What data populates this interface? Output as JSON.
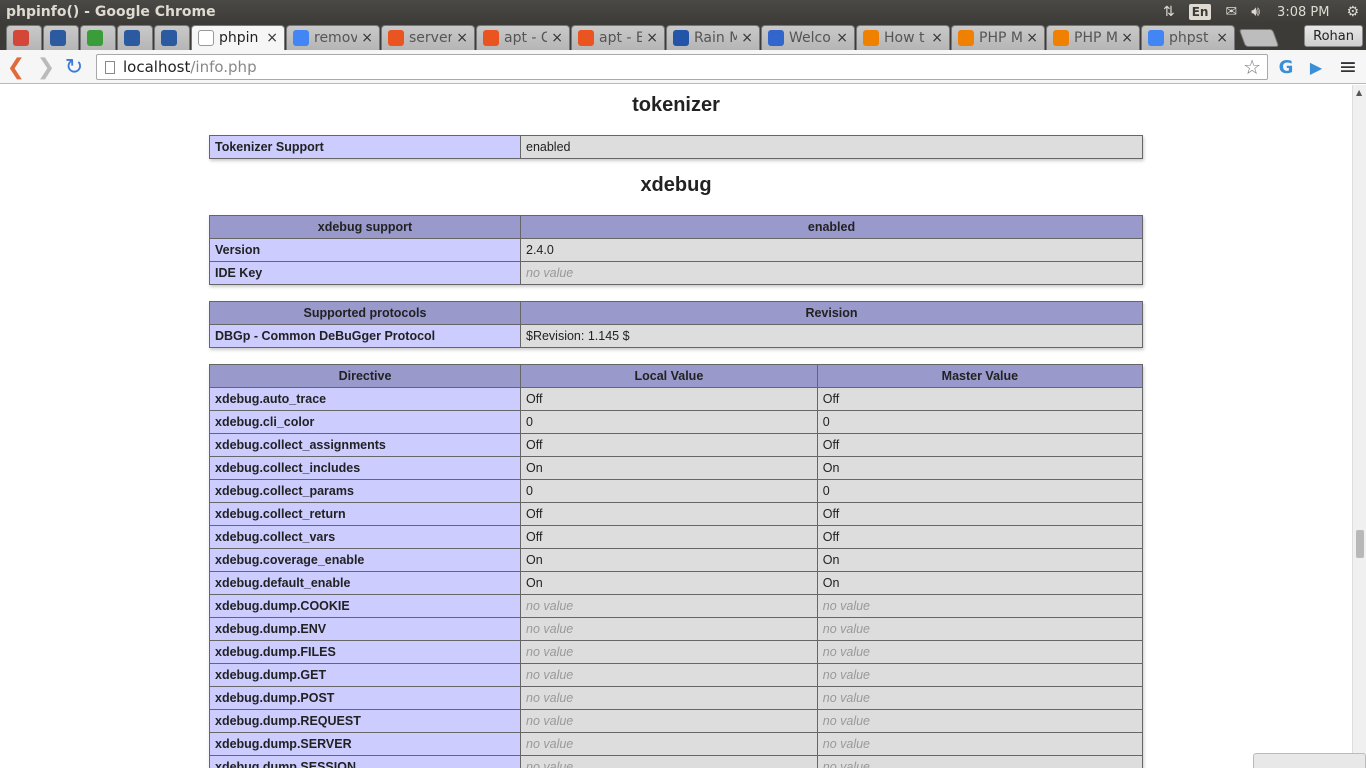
{
  "os_panel": {
    "window_title": "phpinfo() - Google Chrome",
    "lang": "En",
    "clock": "3:08 PM",
    "icons": [
      "network-updown-icon",
      "mail-icon",
      "volume-icon",
      "settings-gear-icon"
    ]
  },
  "tabs": [
    {
      "label": "",
      "favicon": "gmail-icon",
      "color": "#d44638",
      "active": false
    },
    {
      "label": "",
      "favicon": "jenkins-icon",
      "color": "#2c5aa0",
      "active": false
    },
    {
      "label": "",
      "favicon": "speedometer-icon",
      "color": "#3a9d3a",
      "active": false
    },
    {
      "label": "",
      "favicon": "jenkins-icon",
      "color": "#2c5aa0",
      "active": false
    },
    {
      "label": "",
      "favicon": "jenkins-icon",
      "color": "#2c5aa0",
      "active": false
    },
    {
      "label": "phpin",
      "favicon": "page-icon",
      "color": "#ffffff",
      "active": true
    },
    {
      "label": "remov",
      "favicon": "google-icon",
      "color": "#4285f4",
      "active": false
    },
    {
      "label": "server",
      "favicon": "askubuntu-icon",
      "color": "#e95420",
      "active": false
    },
    {
      "label": "apt - C",
      "favicon": "askubuntu-icon",
      "color": "#e95420",
      "active": false
    },
    {
      "label": "apt - E",
      "favicon": "askubuntu-icon",
      "color": "#e95420",
      "active": false
    },
    {
      "label": "Rain M",
      "favicon": "grid-icon",
      "color": "#2255aa",
      "active": false
    },
    {
      "label": "Welco",
      "favicon": "grid-icon",
      "color": "#3366cc",
      "active": false
    },
    {
      "label": "How t",
      "favicon": "sublime-icon",
      "color": "#f08000",
      "active": false
    },
    {
      "label": "PHP M",
      "favicon": "sublime-icon",
      "color": "#f08000",
      "active": false
    },
    {
      "label": "PHP M",
      "favicon": "sublime-icon",
      "color": "#f08000",
      "active": false
    },
    {
      "label": "phpst",
      "favicon": "google-icon",
      "color": "#4285f4",
      "active": false
    }
  ],
  "profile": "Rohan",
  "toolbar": {
    "url_host": "localhost",
    "url_path": "/info.php"
  },
  "page": {
    "tokenizer": {
      "heading": "tokenizer",
      "rows": [
        {
          "key": "Tokenizer Support",
          "value": "enabled"
        }
      ]
    },
    "xdebug": {
      "heading": "xdebug",
      "support_header": [
        "xdebug support",
        "enabled"
      ],
      "support_rows": [
        {
          "key": "Version",
          "value": "2.4.0"
        },
        {
          "key": "IDE Key",
          "value": "no value"
        }
      ],
      "protocols_header": [
        "Supported protocols",
        "Revision"
      ],
      "protocols_rows": [
        {
          "key": "DBGp - Common DeBuGger Protocol",
          "value": "$Revision: 1.145 $"
        }
      ],
      "directives_header": [
        "Directive",
        "Local Value",
        "Master Value"
      ],
      "directives": [
        {
          "name": "xdebug.auto_trace",
          "local": "Off",
          "master": "Off"
        },
        {
          "name": "xdebug.cli_color",
          "local": "0",
          "master": "0"
        },
        {
          "name": "xdebug.collect_assignments",
          "local": "Off",
          "master": "Off"
        },
        {
          "name": "xdebug.collect_includes",
          "local": "On",
          "master": "On"
        },
        {
          "name": "xdebug.collect_params",
          "local": "0",
          "master": "0"
        },
        {
          "name": "xdebug.collect_return",
          "local": "Off",
          "master": "Off"
        },
        {
          "name": "xdebug.collect_vars",
          "local": "Off",
          "master": "Off"
        },
        {
          "name": "xdebug.coverage_enable",
          "local": "On",
          "master": "On"
        },
        {
          "name": "xdebug.default_enable",
          "local": "On",
          "master": "On"
        },
        {
          "name": "xdebug.dump.COOKIE",
          "local": "no value",
          "master": "no value"
        },
        {
          "name": "xdebug.dump.ENV",
          "local": "no value",
          "master": "no value"
        },
        {
          "name": "xdebug.dump.FILES",
          "local": "no value",
          "master": "no value"
        },
        {
          "name": "xdebug.dump.GET",
          "local": "no value",
          "master": "no value"
        },
        {
          "name": "xdebug.dump.POST",
          "local": "no value",
          "master": "no value"
        },
        {
          "name": "xdebug.dump.REQUEST",
          "local": "no value",
          "master": "no value"
        },
        {
          "name": "xdebug.dump.SERVER",
          "local": "no value",
          "master": "no value"
        },
        {
          "name": "xdebug.dump.SESSION",
          "local": "no value",
          "master": "no value"
        }
      ]
    }
  }
}
